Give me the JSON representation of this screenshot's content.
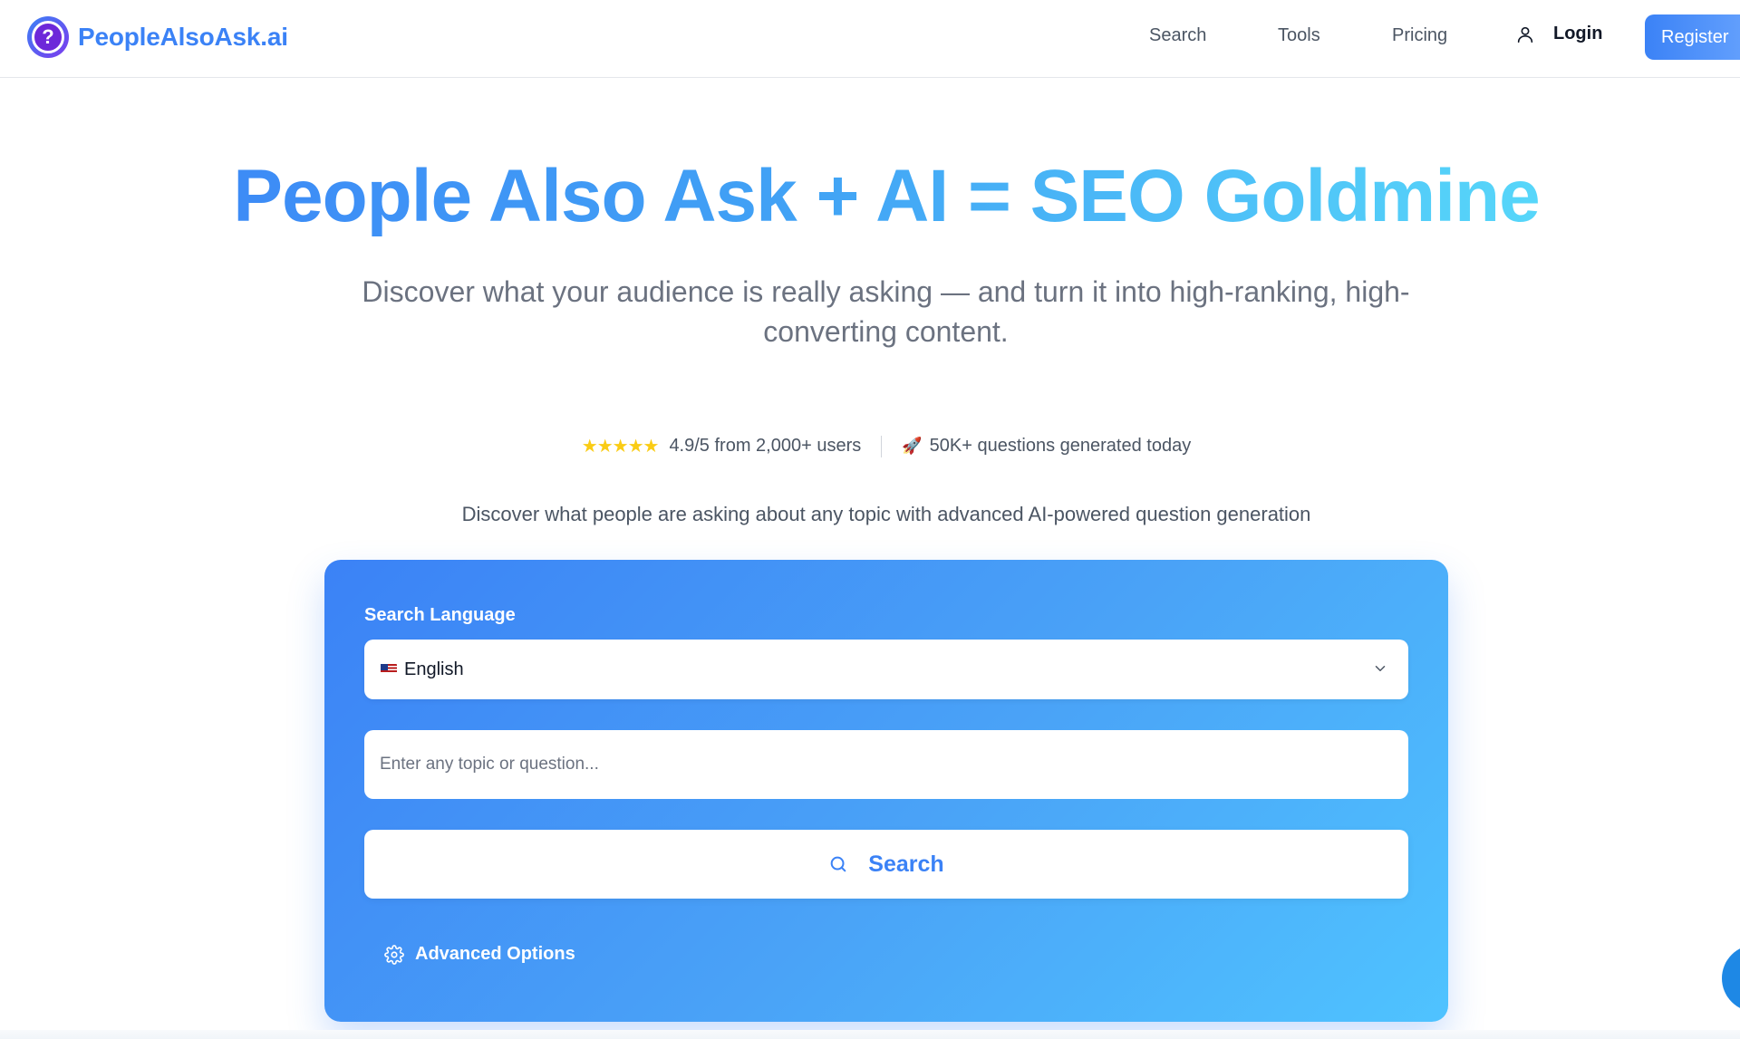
{
  "header": {
    "brand_name": "PeopleAlsoAsk.ai",
    "nav": [
      {
        "label": "Search"
      },
      {
        "label": "Tools"
      },
      {
        "label": "Pricing"
      }
    ],
    "login_label": "Login",
    "register_label": "Register"
  },
  "hero": {
    "title": "People Also Ask + AI = SEO Goldmine",
    "subtitle": "Discover what your audience is really asking — and turn it into high-ranking, high-converting content.",
    "rating_stars": "★★★★★",
    "rating_text": "4.9/5 from 2,000+ users",
    "rocket_emoji": "🚀",
    "generated_text": "50K+ questions generated today",
    "tagline": "Discover what people are asking about any topic with advanced AI-powered question generation"
  },
  "search_card": {
    "language_label": "Search Language",
    "language_value": "English",
    "topic_placeholder": "Enter any topic or question...",
    "search_label": "Search",
    "advanced_label": "Advanced Options"
  },
  "icons": {
    "brand": "question-mark-logo-icon",
    "login": "user-icon",
    "language": "us-flag-icon",
    "dropdown": "chevron-down-icon",
    "search": "search-icon",
    "advanced": "gear-icon"
  },
  "colors": {
    "brand_blue": "#3b82f6",
    "gradient_end": "#5ee7fb",
    "star_yellow": "#facc15"
  }
}
